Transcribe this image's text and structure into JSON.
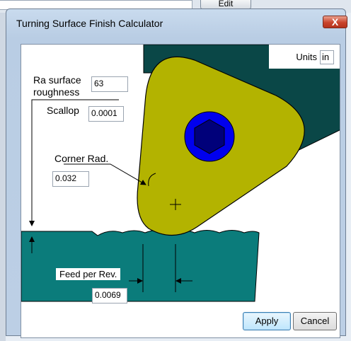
{
  "background": {
    "edit_label": "Edit"
  },
  "dialog": {
    "title": "Turning Surface Finish Calculator",
    "close_glyph": "X",
    "units": {
      "label": "Units",
      "value": "in"
    },
    "ra": {
      "label_line1": "Ra surface",
      "label_line2": "roughness",
      "value": "63"
    },
    "scallop": {
      "label": "Scallop",
      "value": "0.0001"
    },
    "corner_radius": {
      "label": "Corner Rad.",
      "value": "0.032"
    },
    "feed": {
      "label": "Feed per Rev.",
      "value": "0.0069"
    },
    "buttons": {
      "apply": "Apply",
      "cancel": "Cancel"
    }
  },
  "colors": {
    "workpiece": "#0b7c7b",
    "insert": "#b3b300",
    "holder": "#0a4747",
    "screw": "#0000ee",
    "screw_socket": "#00007a"
  },
  "icons": {
    "crosshair": "plus-marker-icon",
    "screw": "hex-socket-screw-icon"
  }
}
